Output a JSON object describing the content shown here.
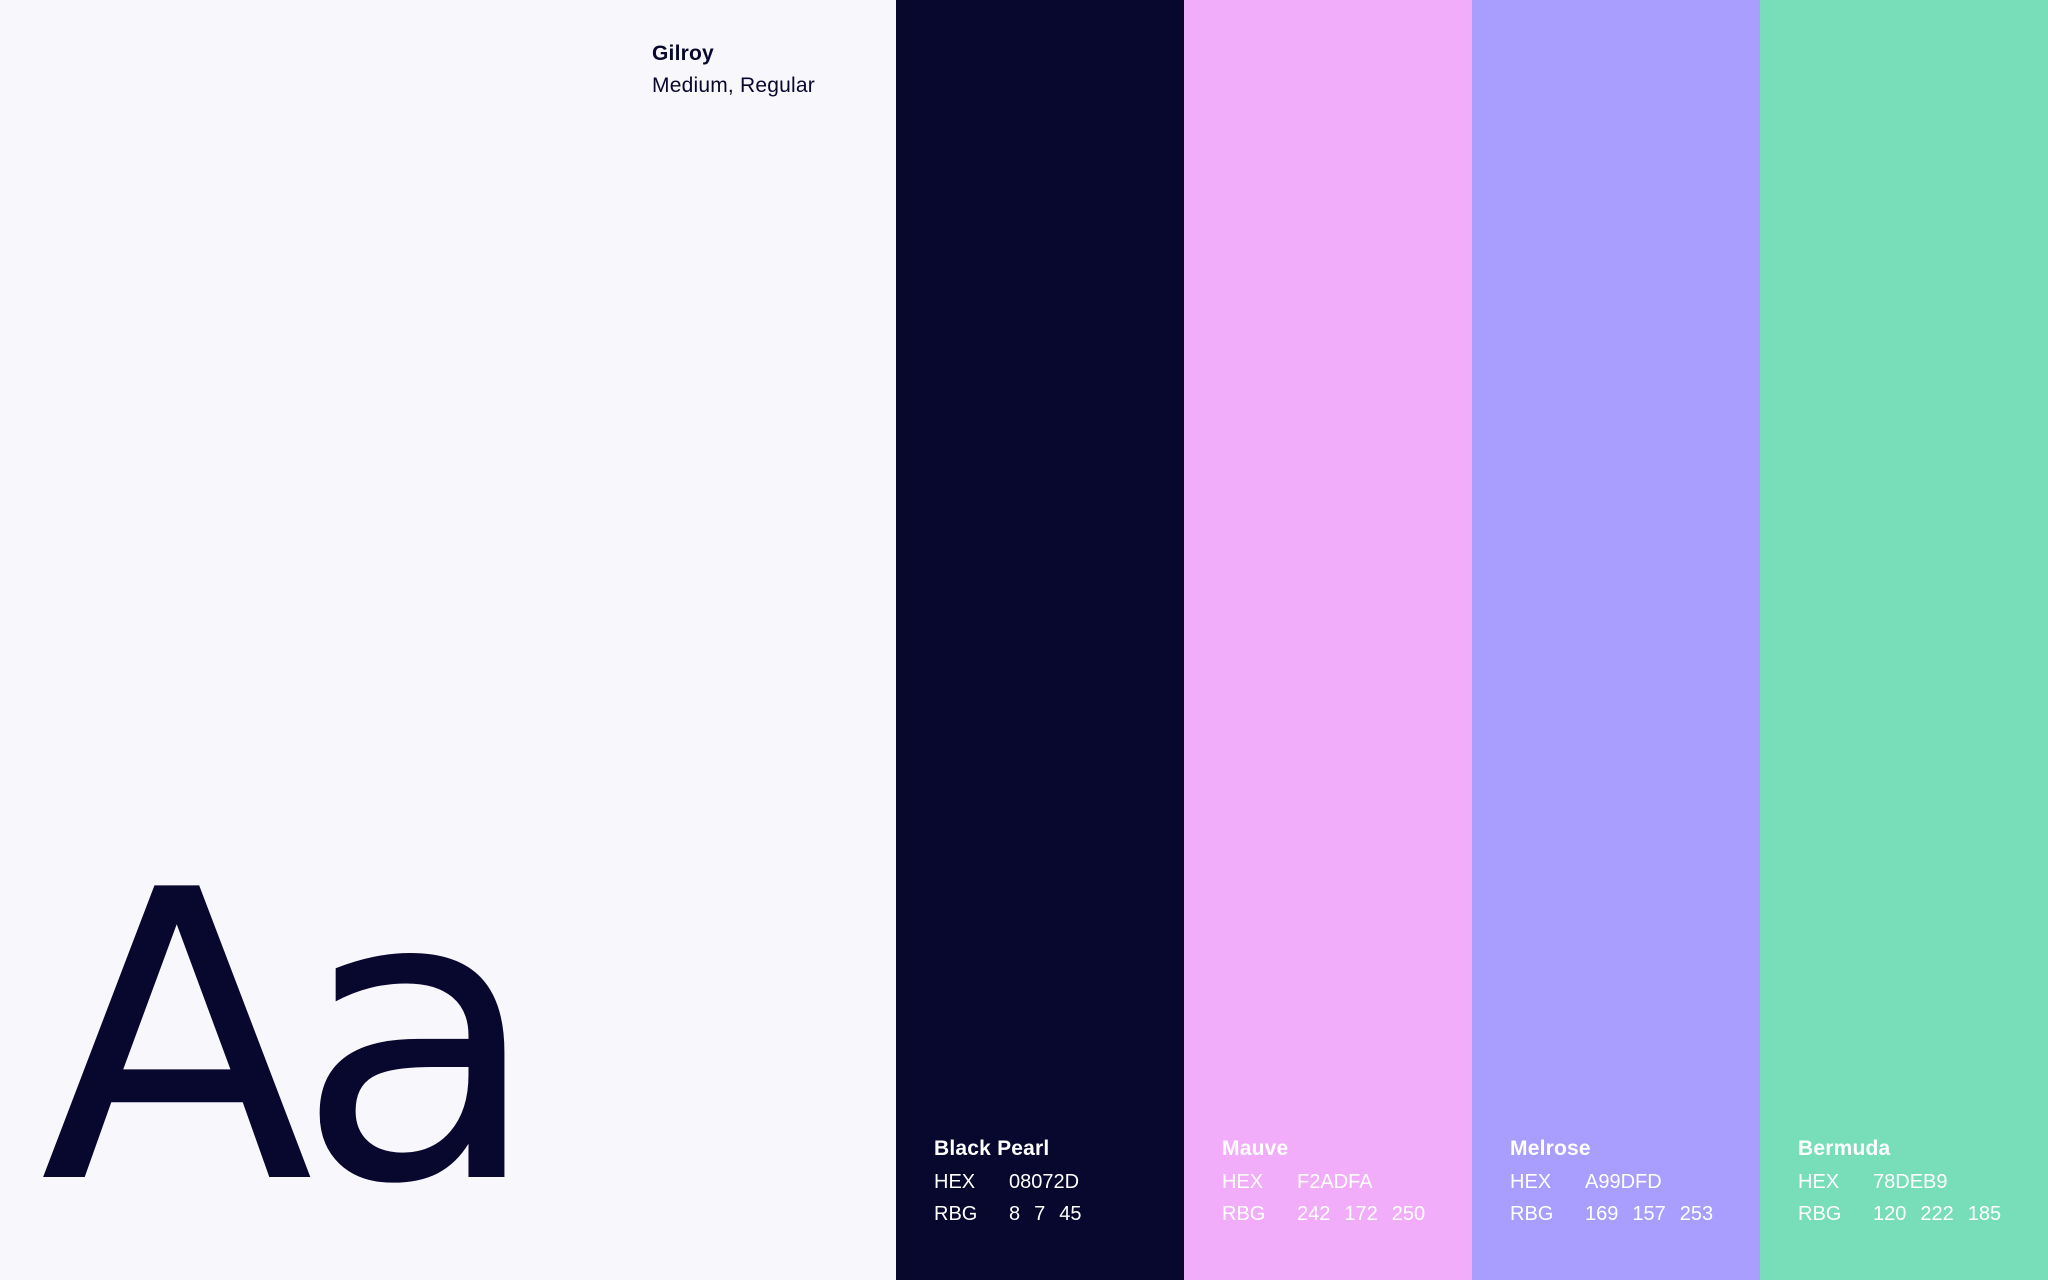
{
  "typography": {
    "font_name": "Gilroy",
    "font_weights": "Medium, Regular",
    "specimen": "Aa"
  },
  "swatches": [
    {
      "name": "Black Pearl",
      "color": "#08072D",
      "text_color": "#FFFFFF",
      "hex_label": "HEX",
      "hex": "08072D",
      "rgb_label": "RBG",
      "r": "8",
      "g": "7",
      "b": "45"
    },
    {
      "name": "Mauve",
      "color": "#F2ADFA",
      "text_color": "#FFFFFF",
      "hex_label": "HEX",
      "hex": "F2ADFA",
      "rgb_label": "RBG",
      "r": "242",
      "g": "172",
      "b": "250"
    },
    {
      "name": "Melrose",
      "color": "#A99DFD",
      "text_color": "#FFFFFF",
      "hex_label": "HEX",
      "hex": "A99DFD",
      "rgb_label": "RBG",
      "r": "169",
      "g": "157",
      "b": "253"
    },
    {
      "name": "Bermuda",
      "color": "#78DEB9",
      "text_color": "#FFFFFF",
      "hex_label": "HEX",
      "hex": "78DEB9",
      "rgb_label": "RBG",
      "r": "120",
      "g": "222",
      "b": "185"
    }
  ]
}
